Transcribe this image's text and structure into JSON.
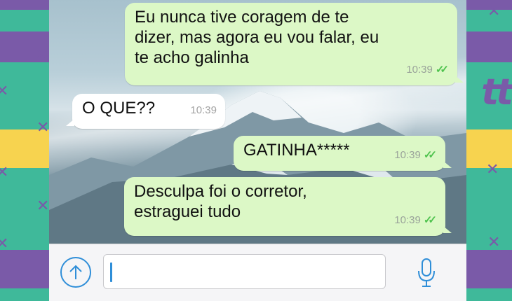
{
  "colors": {
    "outgoing_bubble": "#dcf8c6",
    "incoming_bubble": "#ffffff",
    "read_ticks": "#4fc34e",
    "accent": "#2f8ed8"
  },
  "messages": [
    {
      "direction": "outgoing",
      "lines": [
        "Eu nunca tive coragem de te",
        "dizer, mas agora eu vou falar, eu",
        "te acho galinha"
      ],
      "time": "10:39",
      "status": "read-double-check-icon"
    },
    {
      "direction": "incoming",
      "lines": [
        "O QUE??"
      ],
      "time": "10:39"
    },
    {
      "direction": "outgoing",
      "lines": [
        "GATINHA*****"
      ],
      "time": "10:39",
      "status": "read-double-check-icon"
    },
    {
      "direction": "outgoing",
      "lines": [
        "Desculpa foi o corretor,",
        "estraguei tudo"
      ],
      "time": "10:39",
      "status": "read-double-check-icon"
    }
  ],
  "input_bar": {
    "attach_icon": "upload-arrow-icon",
    "text_value": "",
    "mic_icon": "microphone-icon"
  },
  "decoration": {
    "side_text": "tt"
  }
}
